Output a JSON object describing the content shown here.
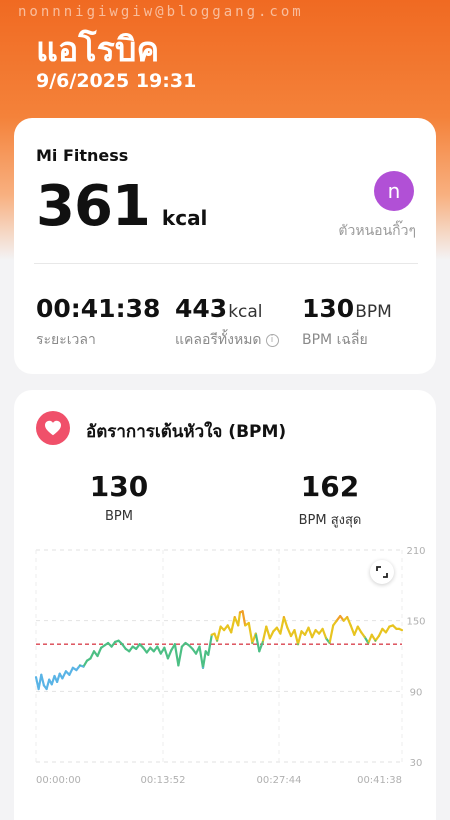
{
  "watermark": "nonnnigiwgiw@bloggang.com",
  "activity": {
    "title": "แอโรบิค",
    "datetime": "9/6/2025 19:31"
  },
  "summary": {
    "app_name": "Mi Fitness",
    "calories_value": "361",
    "calories_unit": "kcal",
    "avatar_letter": "n",
    "nickname": "ตัวหนอนกิ๊วๆ",
    "duration_value": "00:41:38",
    "duration_label": "ระยะเวลา",
    "total_cal_value": "443",
    "total_cal_unit": "kcal",
    "total_cal_label": "แคลอรีทั้งหมด",
    "avg_bpm_value": "130",
    "avg_bpm_unit": "BPM",
    "avg_bpm_label": "BPM เฉลี่ย"
  },
  "heart_rate": {
    "title": "อัตราการเต้นหัวใจ (BPM)",
    "avg_value": "130",
    "avg_label": "BPM",
    "max_value": "162",
    "max_label": "BPM สูงสุด"
  },
  "colors": {
    "brand_orange": "#f06a22",
    "heart_red": "#f0506a",
    "avatar_purple": "#b150d6",
    "zone_blue": "#5ab4e6",
    "zone_green": "#4cbf84",
    "zone_yellow": "#e8c420",
    "zone_orange": "#f0a028",
    "avg_line": "#d9434f"
  },
  "icons": {
    "heart": "heart-icon",
    "info": "info-icon",
    "expand": "expand-icon"
  },
  "chart_data": {
    "type": "line",
    "title": "",
    "xlabel": "",
    "ylabel": "",
    "y_ticks": [
      "210",
      "150",
      "90",
      "30"
    ],
    "ylim": [
      30,
      210
    ],
    "x_ticks": [
      "00:00:00",
      "00:13:52",
      "00:27:44",
      "00:41:38"
    ],
    "xlim_minutes": [
      0,
      41.63
    ],
    "average_line": 130,
    "grid": true,
    "series": [
      {
        "points": [
          [
            0.0,
            102
          ],
          [
            0.3,
            92
          ],
          [
            0.6,
            104
          ],
          [
            0.9,
            95
          ],
          [
            1.2,
            92
          ],
          [
            1.5,
            100
          ],
          [
            1.8,
            96
          ],
          [
            2.1,
            103
          ],
          [
            2.4,
            98
          ],
          [
            2.7,
            105
          ],
          [
            3.0,
            101
          ],
          [
            3.4,
            107
          ],
          [
            3.8,
            104
          ],
          [
            4.2,
            110
          ],
          [
            4.6,
            108
          ],
          [
            5.0,
            112
          ],
          [
            5.4,
            111
          ],
          [
            5.8,
            116
          ],
          [
            6.2,
            118
          ],
          [
            6.6,
            124
          ],
          [
            7.0,
            120
          ],
          [
            7.4,
            127
          ],
          [
            7.8,
            129
          ],
          [
            8.2,
            131
          ],
          [
            8.6,
            128
          ],
          [
            9.0,
            132
          ],
          [
            9.4,
            133
          ],
          [
            9.8,
            130
          ],
          [
            10.2,
            126
          ],
          [
            10.6,
            124
          ],
          [
            11.0,
            128
          ],
          [
            11.4,
            126
          ],
          [
            11.8,
            130
          ],
          [
            12.2,
            127
          ],
          [
            12.6,
            123
          ],
          [
            13.0,
            127
          ],
          [
            13.4,
            124
          ],
          [
            13.8,
            128
          ],
          [
            14.2,
            122
          ],
          [
            14.6,
            127
          ],
          [
            15.0,
            118
          ],
          [
            15.4,
            125
          ],
          [
            15.8,
            130
          ],
          [
            16.2,
            112
          ],
          [
            16.6,
            128
          ],
          [
            17.0,
            131
          ],
          [
            17.4,
            129
          ],
          [
            17.8,
            126
          ],
          [
            18.2,
            122
          ],
          [
            18.6,
            128
          ],
          [
            19.0,
            110
          ],
          [
            19.3,
            124
          ],
          [
            19.6,
            121
          ],
          [
            20.0,
            138
          ],
          [
            20.3,
            139
          ],
          [
            20.6,
            133
          ],
          [
            21.0,
            145
          ],
          [
            21.4,
            142
          ],
          [
            21.8,
            146
          ],
          [
            22.2,
            140
          ],
          [
            22.6,
            153
          ],
          [
            23.0,
            146
          ],
          [
            23.2,
            157
          ],
          [
            23.5,
            158
          ],
          [
            23.8,
            146
          ],
          [
            24.2,
            148
          ],
          [
            24.6,
            131
          ],
          [
            25.0,
            139
          ],
          [
            25.4,
            124
          ],
          [
            25.8,
            132
          ],
          [
            26.2,
            145
          ],
          [
            26.6,
            135
          ],
          [
            27.0,
            141
          ],
          [
            27.4,
            144
          ],
          [
            27.8,
            139
          ],
          [
            28.2,
            153
          ],
          [
            28.6,
            144
          ],
          [
            29.0,
            137
          ],
          [
            29.4,
            142
          ],
          [
            29.8,
            130
          ],
          [
            30.2,
            141
          ],
          [
            30.6,
            138
          ],
          [
            31.0,
            144
          ],
          [
            31.4,
            136
          ],
          [
            31.8,
            142
          ],
          [
            32.2,
            139
          ],
          [
            32.6,
            143
          ],
          [
            33.0,
            135
          ],
          [
            33.4,
            131
          ],
          [
            33.8,
            146
          ],
          [
            34.2,
            150
          ],
          [
            34.6,
            154
          ],
          [
            35.0,
            150
          ],
          [
            35.4,
            153
          ],
          [
            35.8,
            146
          ],
          [
            36.2,
            138
          ],
          [
            36.6,
            145
          ],
          [
            37.0,
            140
          ],
          [
            37.4,
            136
          ],
          [
            37.8,
            131
          ],
          [
            38.2,
            138
          ],
          [
            38.6,
            133
          ],
          [
            39.0,
            137
          ],
          [
            39.4,
            143
          ],
          [
            39.8,
            140
          ],
          [
            40.2,
            145
          ],
          [
            40.6,
            146
          ],
          [
            41.0,
            143
          ],
          [
            41.3,
            143
          ],
          [
            41.63,
            142
          ]
        ]
      }
    ]
  }
}
